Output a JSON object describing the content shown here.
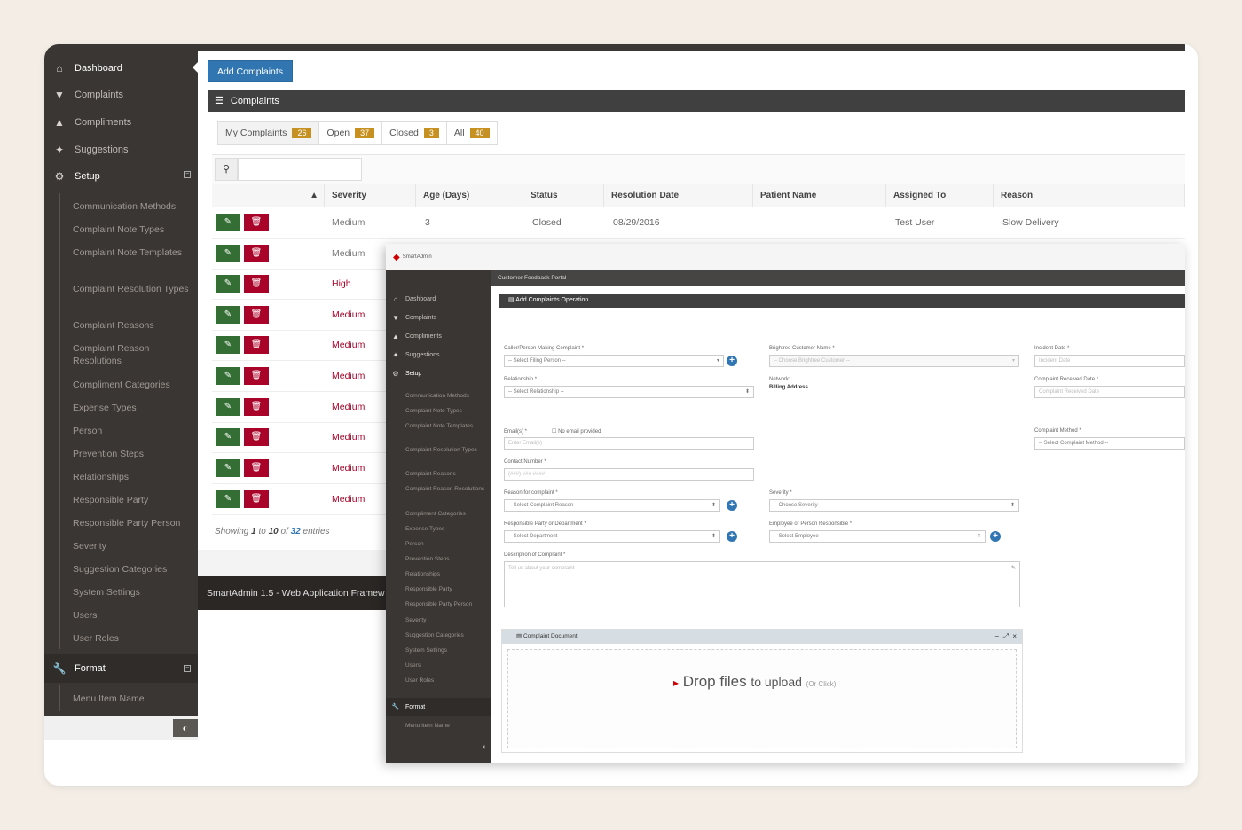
{
  "sidebar": {
    "items": [
      {
        "label": "Dashboard",
        "icon": "home-icon"
      },
      {
        "label": "Complaints",
        "icon": "thumbs-down-icon"
      },
      {
        "label": "Compliments",
        "icon": "thumbs-up-icon"
      },
      {
        "label": "Suggestions",
        "icon": "lightbulb-icon"
      }
    ],
    "setup_label": "Setup",
    "setup_items": [
      "Communication Methods",
      "Complaint Note Types",
      "Complaint Note Templates",
      "Complaint Resolution Types",
      "Complaint Reasons",
      "Complaint Reason Resolutions",
      "Compliment Categories",
      "Expense Types",
      "Person",
      "Prevention Steps",
      "Relationships",
      "Responsible Party",
      "Responsible Party Person",
      "Severity",
      "Suggestion Categories",
      "System Settings",
      "Users",
      "User Roles"
    ],
    "format_label": "Format",
    "format_items": [
      "Menu Item Name"
    ]
  },
  "main": {
    "add_button": "Add Complaints",
    "widget_title": "Complaints",
    "tabs": [
      {
        "label": "My Complaints",
        "count": "26"
      },
      {
        "label": "Open",
        "count": "37"
      },
      {
        "label": "Closed",
        "count": "3"
      },
      {
        "label": "All",
        "count": "40"
      }
    ],
    "columns": [
      "Severity",
      "Age (Days)",
      "Status",
      "Resolution Date",
      "Patient Name",
      "Assigned To",
      "Reason"
    ],
    "rows": [
      {
        "severity": "Medium",
        "age": "3",
        "status": "Closed",
        "resolution_date": "08/29/2016",
        "patient": "",
        "assigned": "Test User",
        "reason": "Slow Delivery",
        "red": false
      },
      {
        "severity": "Medium",
        "red": false
      },
      {
        "severity": "High",
        "red": true
      },
      {
        "severity": "Medium",
        "red": true
      },
      {
        "severity": "Medium",
        "red": true
      },
      {
        "severity": "Medium",
        "red": true
      },
      {
        "severity": "Medium",
        "red": true
      },
      {
        "severity": "Medium",
        "red": true
      },
      {
        "severity": "Medium",
        "red": true
      },
      {
        "severity": "Medium",
        "red": true
      }
    ],
    "showing": {
      "prefix": "Showing",
      "from": "1",
      "to_word": "to",
      "to": "10",
      "of_word": "of",
      "total": "32",
      "suffix": "entries"
    },
    "footer": "SmartAdmin 1.5 - Web Application Framew"
  },
  "overlay": {
    "logo": "SmartAdmin",
    "ribbon": "Customer Feedback Portal",
    "widget_title": "Add Complaints Operation",
    "sidebar_items": [
      "Dashboard",
      "Complaints",
      "Compliments",
      "Suggestions"
    ],
    "setup_label": "Setup",
    "setup_items": [
      "Communication Methods",
      "Complaint Note Types",
      "Complaint Note Templates",
      "Complaint Resolution Types",
      "Complaint Reasons",
      "Complaint Reason Resolutions",
      "Compliment Categories",
      "Expense Types",
      "Person",
      "Prevention Steps",
      "Relationships",
      "Responsible Party",
      "Responsible Party Person",
      "Severity",
      "Suggestion Categories",
      "System Settings",
      "Users",
      "User Roles"
    ],
    "format_label": "Format",
    "format_items": [
      "Menu Item Name"
    ],
    "form": {
      "caller_label": "Caller/Person Making Complaint *",
      "caller_value": "-- Select Filing Person --",
      "customer_label": "Brightree Customer Name *",
      "customer_value": "-- Choose Brightree Customer --",
      "incident_label": "Incident Date *",
      "incident_placeholder": "Incident Date",
      "relationship_label": "Relationship *",
      "relationship_value": "-- Select Relationship --",
      "network_label": "Network:",
      "billing_label": "Billing Address",
      "received_label": "Complaint Received Date *",
      "received_placeholder": "Complaint Received Date",
      "email_label": "Email(s) *",
      "noemail_label": "No email provided",
      "email_placeholder": "Enter Email(s)",
      "method_label": "Complaint Method *",
      "method_value": "-- Select Complaint Method --",
      "contact_label": "Contact Number *",
      "contact_placeholder": "(###) ###-####",
      "reason_label": "Reason for complaint *",
      "reason_value": "-- Select Complaint Reason --",
      "severity_label": "Severity *",
      "severity_value": "-- Choose Severity --",
      "party_label": "Responsible Party or Department *",
      "party_value": "-- Select Department --",
      "employee_label": "Employee or Person Responsible *",
      "employee_value": "-- Select Employee --",
      "desc_label": "Description of Complaint *",
      "desc_placeholder": "Tell us about your complaint"
    },
    "doc_title": "Complaint Document",
    "drop_main": "Drop files",
    "drop_mid": "to upload",
    "drop_small": "(Or Click)"
  }
}
